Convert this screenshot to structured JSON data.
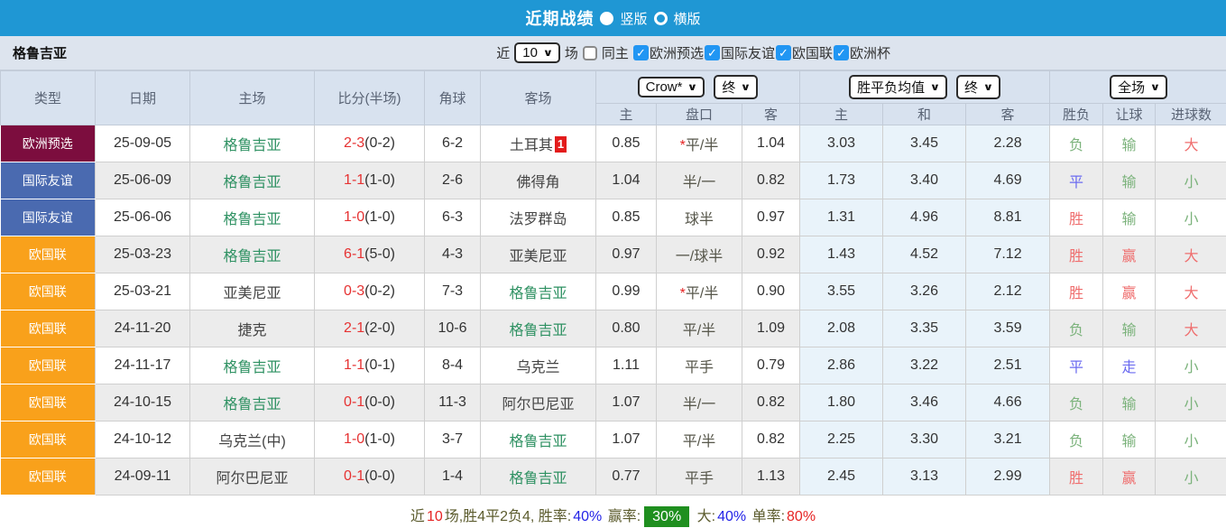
{
  "titlebar": {
    "title": "近期战绩",
    "radio_vertical_label": "竖版",
    "radio_horizontal_label": "横版",
    "selected": "竖版"
  },
  "filter": {
    "team": "格鲁吉亚",
    "near_label": "近",
    "match_count": "10",
    "games_label": "场",
    "same_home_label": "同主",
    "same_home_checked": false,
    "leagues": [
      {
        "label": "欧洲预选",
        "checked": true
      },
      {
        "label": "国际友谊",
        "checked": true
      },
      {
        "label": "欧国联",
        "checked": true
      },
      {
        "label": "欧洲杯",
        "checked": true
      }
    ]
  },
  "table": {
    "headers": [
      "类型",
      "日期",
      "主场",
      "比分(半场)",
      "角球",
      "客场"
    ],
    "selects": {
      "company": "Crow*",
      "company_time": "终",
      "avg": "胜平负均值",
      "avg_time": "终",
      "scope": "全场"
    },
    "sub_headers": [
      "主",
      "盘口",
      "客",
      "主",
      "和",
      "客",
      "胜负",
      "让球",
      "进球数"
    ],
    "rows": [
      {
        "type": "欧洲预选",
        "date": "25-09-05",
        "home": "格鲁吉亚",
        "home_focus": true,
        "score": "2-3",
        "half": "(0-2)",
        "corners": "6-2",
        "away": "土耳其",
        "away_focus": false,
        "away_badge": "1",
        "odds": [
          "0.85",
          "平/半",
          "1.04"
        ],
        "handicap_star": true,
        "avg": [
          "3.03",
          "3.45",
          "2.28"
        ],
        "result": {
          "text": "负",
          "color": "green"
        },
        "let": {
          "text": "输",
          "color": "green"
        },
        "goals": {
          "text": "大",
          "color": "red"
        }
      },
      {
        "type": "国际友谊",
        "date": "25-06-09",
        "home": "格鲁吉亚",
        "home_focus": true,
        "score": "1-1",
        "half": "(1-0)",
        "corners": "2-6",
        "away": "佛得角",
        "away_focus": false,
        "away_badge": "",
        "odds": [
          "1.04",
          "半/一",
          "0.82"
        ],
        "handicap_star": false,
        "avg": [
          "1.73",
          "3.40",
          "4.69"
        ],
        "result": {
          "text": "平",
          "color": "blue"
        },
        "let": {
          "text": "输",
          "color": "green"
        },
        "goals": {
          "text": "小",
          "color": "green"
        }
      },
      {
        "type": "国际友谊",
        "date": "25-06-06",
        "home": "格鲁吉亚",
        "home_focus": true,
        "score": "1-0",
        "half": "(1-0)",
        "corners": "6-3",
        "away": "法罗群岛",
        "away_focus": false,
        "away_badge": "",
        "odds": [
          "0.85",
          "球半",
          "0.97"
        ],
        "handicap_star": false,
        "avg": [
          "1.31",
          "4.96",
          "8.81"
        ],
        "result": {
          "text": "胜",
          "color": "red"
        },
        "let": {
          "text": "输",
          "color": "green"
        },
        "goals": {
          "text": "小",
          "color": "green"
        }
      },
      {
        "type": "欧国联",
        "date": "25-03-23",
        "home": "格鲁吉亚",
        "home_focus": true,
        "score": "6-1",
        "half": "(5-0)",
        "corners": "4-3",
        "away": "亚美尼亚",
        "away_focus": false,
        "away_badge": "",
        "odds": [
          "0.97",
          "一/球半",
          "0.92"
        ],
        "handicap_star": false,
        "avg": [
          "1.43",
          "4.52",
          "7.12"
        ],
        "result": {
          "text": "胜",
          "color": "red"
        },
        "let": {
          "text": "赢",
          "color": "red"
        },
        "goals": {
          "text": "大",
          "color": "red"
        }
      },
      {
        "type": "欧国联",
        "date": "25-03-21",
        "home": "亚美尼亚",
        "home_focus": false,
        "score": "0-3",
        "half": "(0-2)",
        "corners": "7-3",
        "away": "格鲁吉亚",
        "away_focus": true,
        "away_badge": "",
        "odds": [
          "0.99",
          "平/半",
          "0.90"
        ],
        "handicap_star": true,
        "avg": [
          "3.55",
          "3.26",
          "2.12"
        ],
        "result": {
          "text": "胜",
          "color": "red"
        },
        "let": {
          "text": "赢",
          "color": "red"
        },
        "goals": {
          "text": "大",
          "color": "red"
        }
      },
      {
        "type": "欧国联",
        "date": "24-11-20",
        "home": "捷克",
        "home_focus": false,
        "score": "2-1",
        "half": "(2-0)",
        "corners": "10-6",
        "away": "格鲁吉亚",
        "away_focus": true,
        "away_badge": "",
        "odds": [
          "0.80",
          "平/半",
          "1.09"
        ],
        "handicap_star": false,
        "avg": [
          "2.08",
          "3.35",
          "3.59"
        ],
        "result": {
          "text": "负",
          "color": "green"
        },
        "let": {
          "text": "输",
          "color": "green"
        },
        "goals": {
          "text": "大",
          "color": "red"
        }
      },
      {
        "type": "欧国联",
        "date": "24-11-17",
        "home": "格鲁吉亚",
        "home_focus": true,
        "score": "1-1",
        "half": "(0-1)",
        "corners": "8-4",
        "away": "乌克兰",
        "away_focus": false,
        "away_badge": "",
        "odds": [
          "1.11",
          "平手",
          "0.79"
        ],
        "handicap_star": false,
        "avg": [
          "2.86",
          "3.22",
          "2.51"
        ],
        "result": {
          "text": "平",
          "color": "blue"
        },
        "let": {
          "text": "走",
          "color": "blue"
        },
        "goals": {
          "text": "小",
          "color": "green"
        }
      },
      {
        "type": "欧国联",
        "date": "24-10-15",
        "home": "格鲁吉亚",
        "home_focus": true,
        "score": "0-1",
        "half": "(0-0)",
        "corners": "11-3",
        "away": "阿尔巴尼亚",
        "away_focus": false,
        "away_badge": "",
        "odds": [
          "1.07",
          "半/一",
          "0.82"
        ],
        "handicap_star": false,
        "avg": [
          "1.80",
          "3.46",
          "4.66"
        ],
        "result": {
          "text": "负",
          "color": "green"
        },
        "let": {
          "text": "输",
          "color": "green"
        },
        "goals": {
          "text": "小",
          "color": "green"
        }
      },
      {
        "type": "欧国联",
        "date": "24-10-12",
        "home": "乌克兰(中)",
        "home_focus": false,
        "score": "1-0",
        "half": "(1-0)",
        "corners": "3-7",
        "away": "格鲁吉亚",
        "away_focus": true,
        "away_badge": "",
        "odds": [
          "1.07",
          "平/半",
          "0.82"
        ],
        "handicap_star": false,
        "avg": [
          "2.25",
          "3.30",
          "3.21"
        ],
        "result": {
          "text": "负",
          "color": "green"
        },
        "let": {
          "text": "输",
          "color": "green"
        },
        "goals": {
          "text": "小",
          "color": "green"
        }
      },
      {
        "type": "欧国联",
        "date": "24-09-11",
        "home": "阿尔巴尼亚",
        "home_focus": false,
        "score": "0-1",
        "half": "(0-0)",
        "corners": "1-4",
        "away": "格鲁吉亚",
        "away_focus": true,
        "away_badge": "",
        "odds": [
          "0.77",
          "平手",
          "1.13"
        ],
        "handicap_star": false,
        "avg": [
          "2.45",
          "3.13",
          "2.99"
        ],
        "result": {
          "text": "胜",
          "color": "red"
        },
        "let": {
          "text": "赢",
          "color": "red"
        },
        "goals": {
          "text": "小",
          "color": "green"
        }
      }
    ]
  },
  "summary": {
    "segments": [
      {
        "text": "近",
        "style": "label"
      },
      {
        "text": "10",
        "style": "red"
      },
      {
        "text": "场,胜4平2负4, 胜率:",
        "style": "label"
      },
      {
        "text": "40%",
        "style": "blue"
      },
      {
        "text": " 赢率:",
        "style": "label"
      },
      {
        "text": "30%",
        "style": "badge"
      },
      {
        "text": " 大:",
        "style": "label"
      },
      {
        "text": "40%",
        "style": "blue"
      },
      {
        "text": " 单率:",
        "style": "label"
      },
      {
        "text": "80%",
        "style": "red"
      }
    ]
  },
  "colors": {
    "topbar_blue": "#1f97d4",
    "checkbox_blue": "#2196f3",
    "type_colors": {
      "欧洲预选": "#7c0d3e",
      "国际友谊": "#4a6ab0",
      "欧国联": "#f9a11b"
    },
    "team_green": "#2e9162",
    "neutral_team": "#444444",
    "score_red": "#e63232",
    "result_red": "#ef6e6e",
    "result_green": "#7cb37c",
    "result_blue": "#6b6bf0",
    "avg_bg": "#e9f3fa",
    "summary_label": "#5c5c2e",
    "summary_blue": "#2323e6",
    "summary_red": "#e62323",
    "summary_badge_green": "#1f8f1f"
  }
}
